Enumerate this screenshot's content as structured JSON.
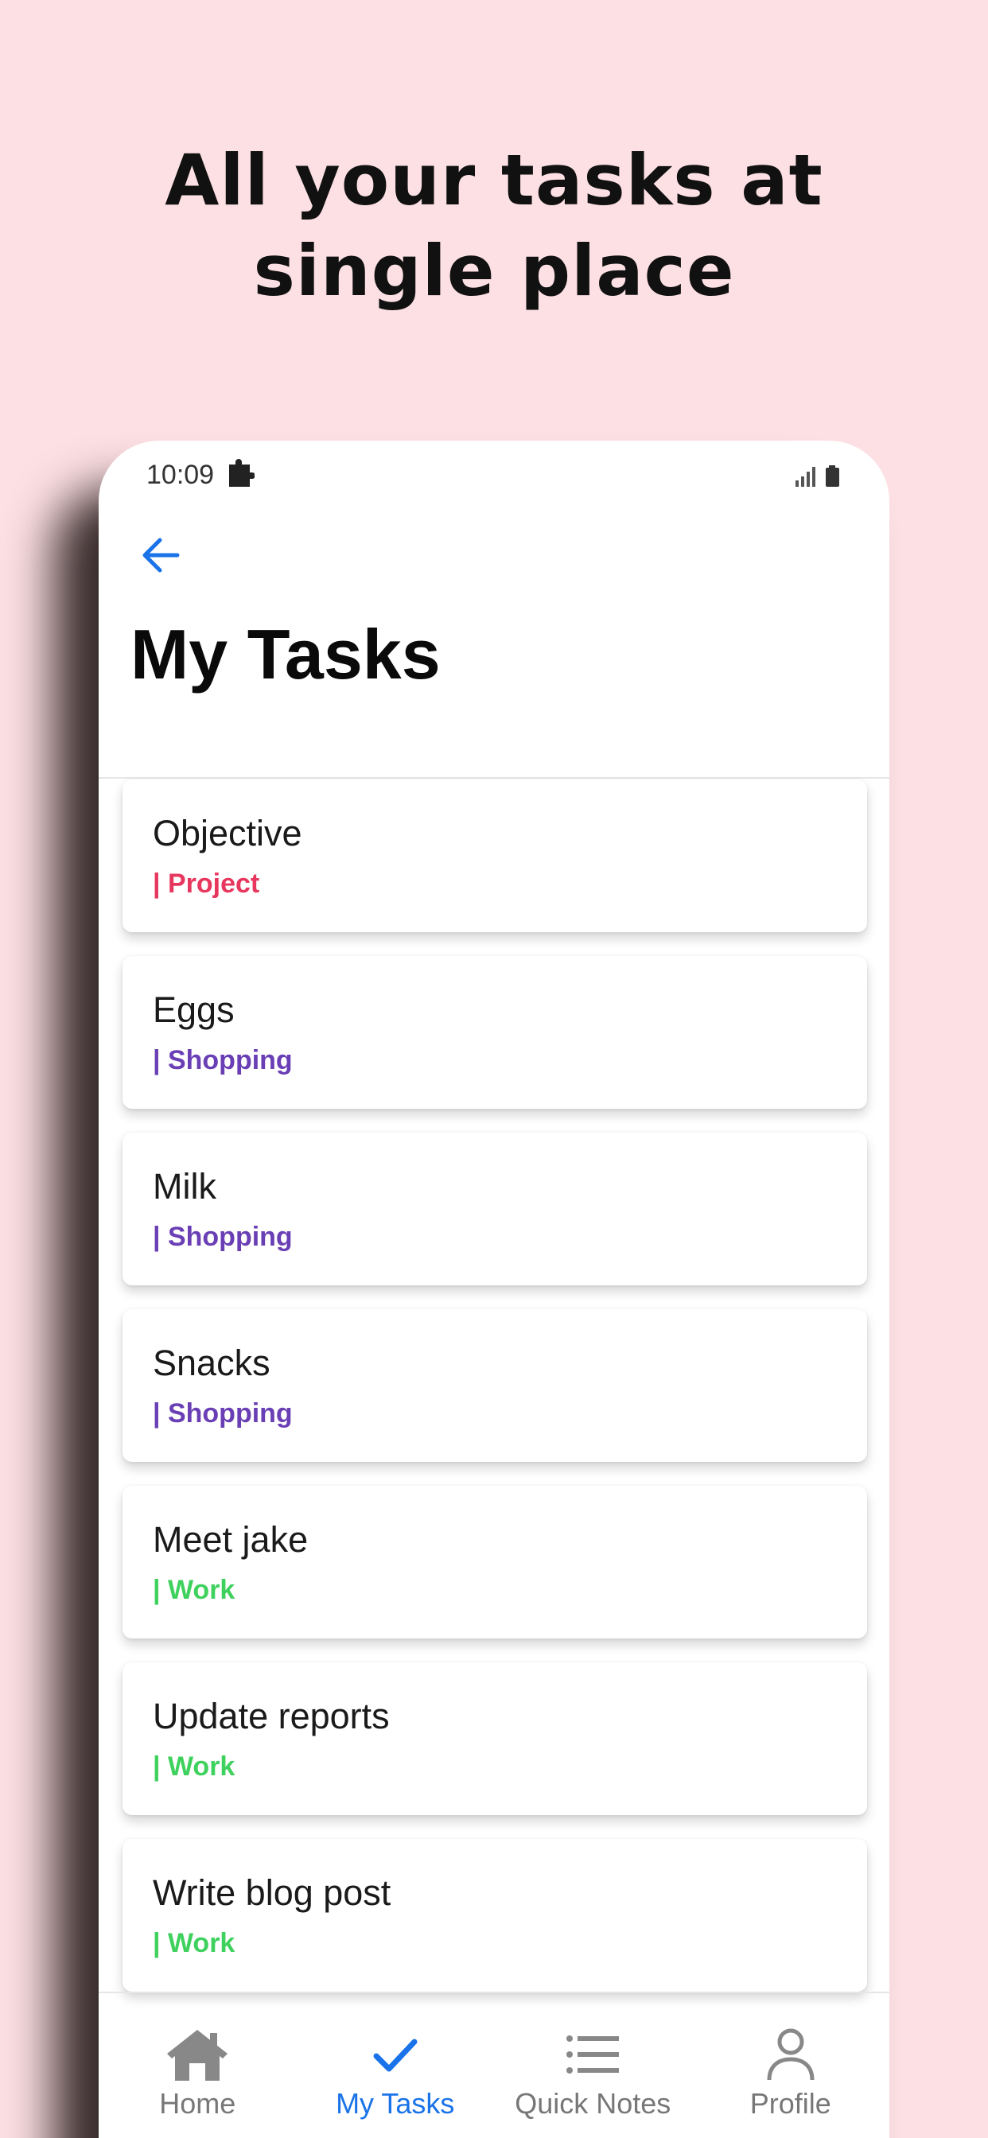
{
  "promo": {
    "headline": "All your tasks at single place"
  },
  "status_bar": {
    "time": "10:09"
  },
  "header": {
    "title": "My Tasks"
  },
  "tasks": [
    {
      "title": "Objective",
      "tag": "| Project",
      "tag_color": "#e8375e"
    },
    {
      "title": "Eggs",
      "tag": "| Shopping",
      "tag_color": "#6a3fb5"
    },
    {
      "title": "Milk",
      "tag": "| Shopping",
      "tag_color": "#6a3fb5"
    },
    {
      "title": "Snacks",
      "tag": "| Shopping",
      "tag_color": "#6a3fb5"
    },
    {
      "title": "Meet jake",
      "tag": "| Work",
      "tag_color": "#3fd15d"
    },
    {
      "title": "Update reports",
      "tag": "| Work",
      "tag_color": "#3fd15d"
    },
    {
      "title": "Write blog post",
      "tag": "| Work",
      "tag_color": "#3fd15d"
    }
  ],
  "tabs": [
    {
      "label": "Home",
      "icon": "home-icon",
      "active": false
    },
    {
      "label": "My Tasks",
      "icon": "check-icon",
      "active": true
    },
    {
      "label": "Quick Notes",
      "icon": "list-icon",
      "active": false
    },
    {
      "label": "Profile",
      "icon": "person-icon",
      "active": false
    }
  ],
  "colors": {
    "background": "#fde0e3",
    "accent": "#1a73e8",
    "project": "#e8375e",
    "shopping": "#6a3fb5",
    "work": "#3fd15d"
  }
}
